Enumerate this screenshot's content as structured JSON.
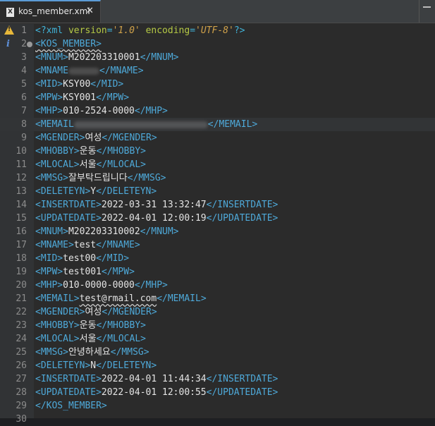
{
  "tab": {
    "title": "kos_member.xml",
    "icon": "xml-file-icon",
    "close_label": "✕"
  },
  "gutter_icons": {
    "warning": "warning-icon",
    "info": "info-icon",
    "fold": "fold-collapse-icon",
    "marker": "bookmark-marker-icon"
  },
  "colors": {
    "tag": "#4ea9d9",
    "text": "#e4e4e4",
    "attr": "#b5c945",
    "attr_value": "#cfa14a",
    "background": "#2b2b2b",
    "gutter": "#313335"
  },
  "xml_decl": {
    "open": "<?xml ",
    "version_attr": "version",
    "eq": "=",
    "version_val": "'1.0'",
    "encoding_attr": "encoding",
    "encoding_val": "'UTF-8'",
    "close": "?>"
  },
  "lines": [
    {
      "n": "1"
    },
    {
      "n": "2",
      "open": "<KOS_MEMBER>"
    },
    {
      "n": "3",
      "open": "<MNUM>",
      "text": "M202203310001",
      "close": "</MNUM>"
    },
    {
      "n": "4",
      "open": "<MNAME",
      "text": "",
      "close": "</MNAME>"
    },
    {
      "n": "5",
      "open": "<MID>",
      "text": "KSY00",
      "close": "</MID>"
    },
    {
      "n": "6",
      "open": "<MPW>",
      "text": "KSY001",
      "close": "</MPW>"
    },
    {
      "n": "7",
      "open": "<MHP>",
      "text": "010-2524-0000",
      "close": "</MHP>"
    },
    {
      "n": "8",
      "open": "<MEMAIL",
      "text": "",
      "close": "</MEMAIL>"
    },
    {
      "n": "9",
      "open": "<MGENDER>",
      "text": "여성",
      "close": "</MGENDER>"
    },
    {
      "n": "10",
      "open": "<MHOBBY>",
      "text": "운동",
      "close": "</MHOBBY>"
    },
    {
      "n": "11",
      "open": "<MLOCAL>",
      "text": "서울",
      "close": "</MLOCAL>"
    },
    {
      "n": "12",
      "open": "<MMSG>",
      "text": "잘부탁드립니다",
      "close": "</MMSG>"
    },
    {
      "n": "13",
      "open": "<DELETEYN>",
      "text": "Y",
      "close": "</DELETEYN>"
    },
    {
      "n": "14",
      "open": "<INSERTDATE>",
      "text": "2022-03-31 13:32:47",
      "close": "</INSERTDATE>"
    },
    {
      "n": "15",
      "open": "<UPDATEDATE>",
      "text": "2022-04-01 12:00:19",
      "close": "</UPDATEDATE>"
    },
    {
      "n": "16",
      "open": "<MNUM>",
      "text": "M202203310002",
      "close": "</MNUM>"
    },
    {
      "n": "17",
      "open": "<MNAME>",
      "text": "test",
      "close": "</MNAME>"
    },
    {
      "n": "18",
      "open": "<MID>",
      "text": "test00",
      "close": "</MID>"
    },
    {
      "n": "19",
      "open": "<MPW>",
      "text": "test001",
      "close": "</MPW>"
    },
    {
      "n": "20",
      "open": "<MHP>",
      "text": "010-0000-0000",
      "close": "</MHP>"
    },
    {
      "n": "21",
      "open": "<MEMAIL>",
      "text": "test@rmail.com",
      "close": "</MEMAIL>"
    },
    {
      "n": "22",
      "open": "<MGENDER>",
      "text": "여성",
      "close": "</MGENDER>"
    },
    {
      "n": "23",
      "open": "<MHOBBY>",
      "text": "운동",
      "close": "</MHOBBY>"
    },
    {
      "n": "24",
      "open": "<MLOCAL>",
      "text": "서울",
      "close": "</MLOCAL>"
    },
    {
      "n": "25",
      "open": "<MMSG>",
      "text": "안녕하세요",
      "close": "</MMSG>"
    },
    {
      "n": "26",
      "open": "<DELETEYN>",
      "text": "N",
      "close": "</DELETEYN>"
    },
    {
      "n": "27",
      "open": "<INSERTDATE>",
      "text": "2022-04-01 11:44:34",
      "close": "</INSERTDATE>"
    },
    {
      "n": "28",
      "open": "<UPDATEDATE>",
      "text": "2022-04-01 12:00:55",
      "close": "</UPDATEDATE>"
    },
    {
      "n": "29",
      "open": "</KOS_MEMBER>"
    },
    {
      "n": "30"
    }
  ]
}
